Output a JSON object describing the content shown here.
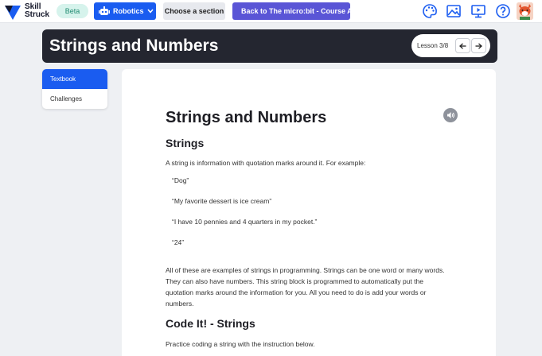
{
  "nav": {
    "logo_text": "Skill\nStruck",
    "beta_label": "Beta",
    "robotics_label": "Robotics",
    "section_label": "Choose a section",
    "back_label": "Back to The micro:bit - Course A",
    "icons": [
      "palette-icon",
      "image-gallery-icon",
      "presentation-icon",
      "help-icon"
    ]
  },
  "banner": {
    "title": "Strings and Numbers",
    "lesson_label": "Lesson 3/8"
  },
  "sidebar": {
    "tabs": [
      {
        "label": "Textbook",
        "active": true
      },
      {
        "label": "Challenges",
        "active": false
      }
    ]
  },
  "content": {
    "heading": "Strings and Numbers",
    "section1_title": "Strings",
    "intro": "A string is information with quotation marks around it. For example:",
    "examples": [
      "“Dog”",
      "“My favorite dessert is ice cream”",
      "“I have 10 pennies and 4 quarters in my pocket.”",
      "“24”"
    ],
    "explanation": "All of these are examples of strings in programming. Strings can be one word or many words. They can also have numbers. This string block is programmed to automatically put the quotation marks around the information for you. All you need to do is add your words or numbers.",
    "section2_title": "Code It! - Strings",
    "practice": "Practice coding a string with the instruction below."
  },
  "colors": {
    "primary": "#1a5cf0",
    "back_button": "#5a55d6",
    "banner_bg": "#242630",
    "beta_bg": "#d6f3ec"
  }
}
